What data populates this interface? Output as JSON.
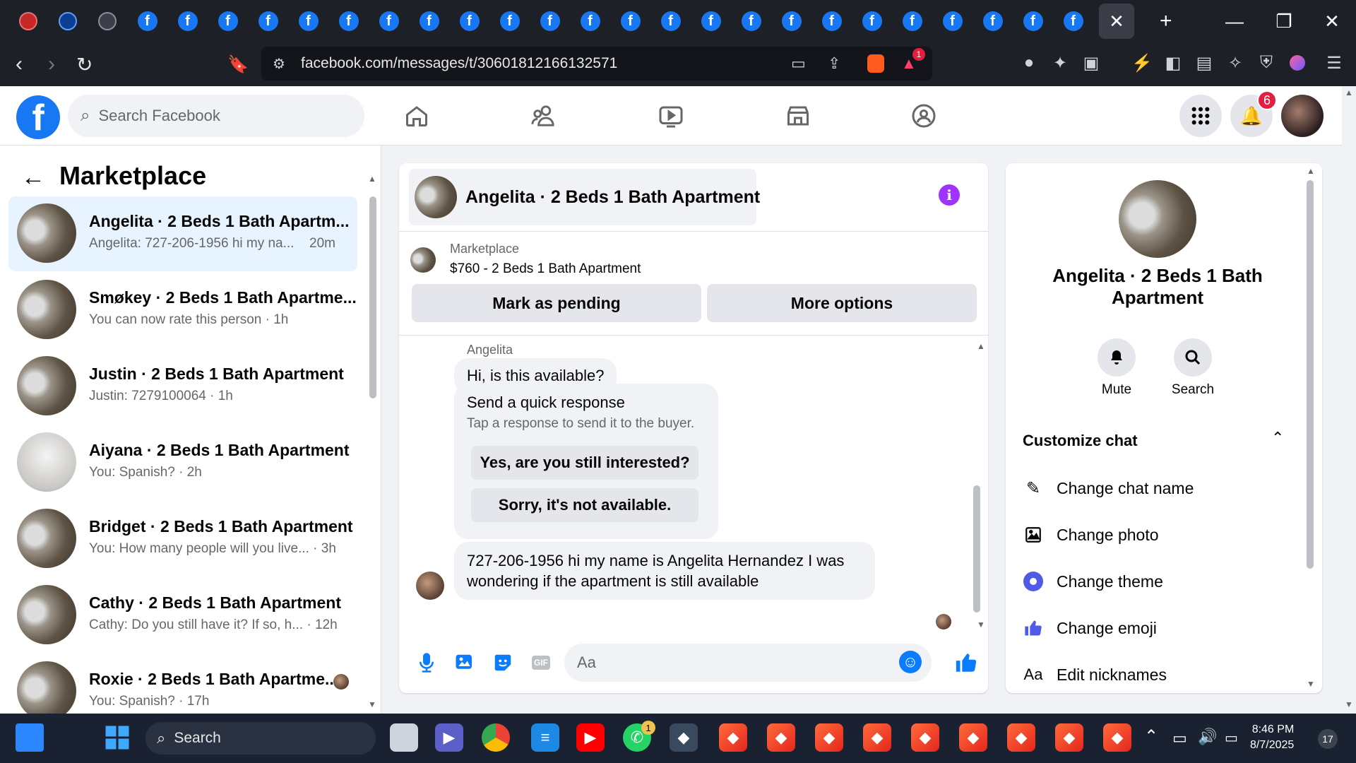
{
  "browser": {
    "active_tab_close": "✕",
    "new_tab": "+",
    "url": "facebook.com/messages/t/30601812166132571",
    "tab_count_fb": 24,
    "brave_badge": "1"
  },
  "header": {
    "search_placeholder": "Search Facebook",
    "notifications_count": "6"
  },
  "left": {
    "title": "Marketplace",
    "conversations": [
      {
        "name": "Angelita · 2 Beds 1 Bath Apartm...",
        "preview": "Angelita: 727-206-1956 hi my na...",
        "time": "20m",
        "active": true
      },
      {
        "name": "Smøkey · 2 Beds 1 Bath Apartme...",
        "preview": "You can now rate this person · 1h",
        "time": ""
      },
      {
        "name": "Justin · 2 Beds 1 Bath Apartment",
        "preview": "Justin: 7279100064 · 1h",
        "time": ""
      },
      {
        "name": "Aiyana · 2 Beds 1 Bath Apartment",
        "preview": "You: Spanish? · 2h",
        "time": ""
      },
      {
        "name": "Bridget · 2 Beds 1 Bath Apartment",
        "preview": "You: How many people will you live... · 3h",
        "time": ""
      },
      {
        "name": "Cathy · 2 Beds 1 Bath Apartment",
        "preview": "Cathy: Do you still have it? If so, h... · 12h",
        "time": ""
      },
      {
        "name": "Roxie · 2 Beds 1 Bath Apartme...",
        "preview": "You: Spanish? · 17h",
        "time": ""
      }
    ]
  },
  "chat": {
    "title": "Angelita · 2 Beds 1 Bath Apartment",
    "listing_category": "Marketplace",
    "listing_price": "$760 - 2 Beds 1 Bath Apartment",
    "mark_pending": "Mark as pending",
    "more_options": "More options",
    "sender": "Angelita",
    "msg1": "Hi, is this available?",
    "qr_title": "Send a quick response",
    "qr_sub": "Tap a response to send it to the buyer.",
    "qr_opt1": "Yes, are you still interested?",
    "qr_opt2": "Sorry, it's not available.",
    "msg2_line1": "727-206-1956 hi my name is Angelita Hernandez I was",
    "msg2_line2": "wondering if the apartment is still available",
    "composer_placeholder": "Aa"
  },
  "info": {
    "name": "Angelita · 2 Beds 1 Bath Apartment",
    "mute": "Mute",
    "search": "Search",
    "customize": "Customize chat",
    "items": [
      {
        "label": "Change chat name",
        "icon": "pencil-icon"
      },
      {
        "label": "Change photo",
        "icon": "photo-icon"
      },
      {
        "label": "Change theme",
        "icon": "theme-icon"
      },
      {
        "label": "Change emoji",
        "icon": "thumbs-up-icon"
      },
      {
        "label": "Edit nicknames",
        "icon": "text-aa-icon"
      }
    ]
  },
  "taskbar": {
    "search": "Search",
    "time": "8:46 PM",
    "date": "8/7/2025",
    "notif_count": "17",
    "whatsapp_badge": "1"
  },
  "colors": {
    "fb_blue": "#1877f2",
    "messenger_blue": "#0a7cff",
    "active_conv": "#e7f3ff",
    "badge_red": "#e41e3f",
    "info_purple": "#a033ff"
  }
}
